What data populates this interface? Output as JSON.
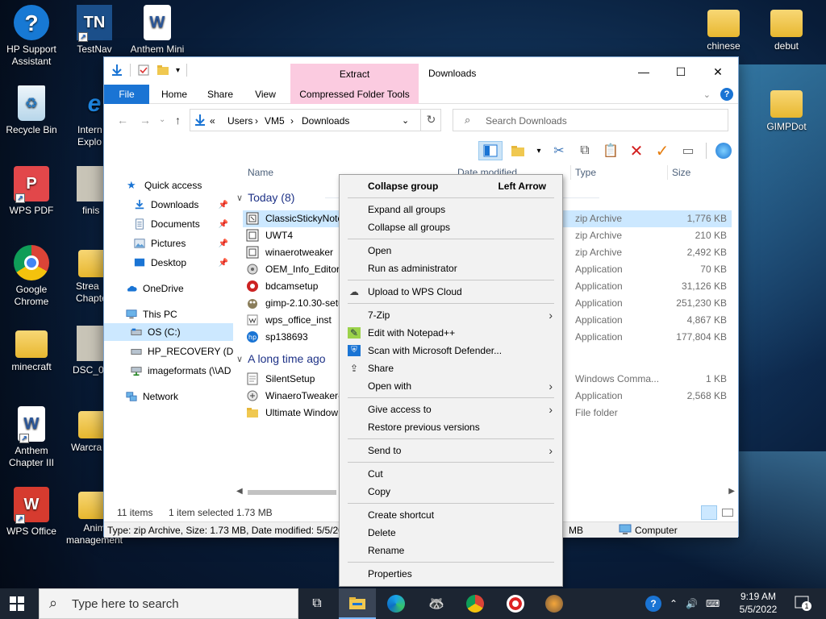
{
  "desktop": {
    "icons_left": [
      {
        "label": "HP Support Assistant"
      },
      {
        "label": "Recycle Bin"
      },
      {
        "label": "WPS PDF"
      },
      {
        "label": "Google Chrome"
      },
      {
        "label": "minecraft"
      },
      {
        "label": "Anthem Chapter III"
      },
      {
        "label": "WPS Office"
      }
    ],
    "icons_col2": [
      {
        "label": "TestNav"
      },
      {
        "label": "Intern Explo"
      },
      {
        "label": "finis"
      },
      {
        "label": "Strea Chapte"
      },
      {
        "label": "DSC_0"
      },
      {
        "label": "Warcra"
      },
      {
        "label": "Anim management"
      }
    ],
    "icon_anthem_mini": "Anthem Mini",
    "icons_right": [
      {
        "label": "chinese"
      },
      {
        "label": "debut"
      },
      {
        "label": "GIMPDot"
      }
    ]
  },
  "explorer": {
    "title": "Downloads",
    "context_tab": "Extract",
    "ribbon_tabs": [
      "File",
      "Home",
      "Share",
      "View",
      "Compressed Folder Tools"
    ],
    "address": {
      "prefix": "«",
      "crumbs": [
        "Users",
        "VM5",
        "Downloads"
      ]
    },
    "search_placeholder": "Search Downloads",
    "nav": {
      "quick_access": "Quick access",
      "pinned": [
        "Downloads",
        "Documents",
        "Pictures",
        "Desktop"
      ],
      "onedrive": "OneDrive",
      "this_pc": "This PC",
      "drives": [
        "OS (C:)",
        "HP_RECOVERY (D:)",
        "imageformats (\\\\AD"
      ],
      "network": "Network"
    },
    "columns": {
      "name": "Name",
      "date": "Date modified",
      "type": "Type",
      "size": "Size"
    },
    "groups": {
      "today": "Today (8)",
      "long_ago": "A long time ago"
    },
    "rows_today": [
      {
        "name": "ClassicStickyNote",
        "type": "zip Archive",
        "size": "1,776 KB"
      },
      {
        "name": "UWT4",
        "type": "zip Archive",
        "size": "210 KB"
      },
      {
        "name": "winaerotweaker",
        "type": "zip Archive",
        "size": "2,492 KB"
      },
      {
        "name": "OEM_Info_Editor",
        "type": "Application",
        "size": "70 KB"
      },
      {
        "name": "bdcamsetup",
        "type": "Application",
        "size": "31,126 KB"
      },
      {
        "name": "gimp-2.10.30-setu",
        "type": "Application",
        "size": "251,230 KB"
      },
      {
        "name": "wps_office_inst",
        "type": "Application",
        "size": "4,867 KB"
      },
      {
        "name": "sp138693",
        "type": "Application",
        "size": "177,804 KB"
      }
    ],
    "rows_old": [
      {
        "name": "SilentSetup",
        "type": "Windows Comma...",
        "size": "1 KB"
      },
      {
        "name": "WinaeroTweaker-",
        "type": "Application",
        "size": "2,568 KB"
      },
      {
        "name": "Ultimate Window",
        "type": "File folder",
        "size": ""
      }
    ],
    "status": {
      "count": "11 items",
      "selected": "1 item selected",
      "sel_size": "1.73 MB"
    },
    "details": {
      "text": "Type: zip Archive, Size: 1.73 MB, Date modified: 5/5/202",
      "size": "MB",
      "location": "Computer"
    }
  },
  "context_menu": {
    "collapse_group": "Collapse group",
    "collapse_group_shortcut": "Left Arrow",
    "expand_all": "Expand all groups",
    "collapse_all": "Collapse all groups",
    "open": "Open",
    "run_admin": "Run as administrator",
    "upload_wps": "Upload to WPS Cloud",
    "sevenzip": "7-Zip",
    "notepadpp": "Edit with Notepad++",
    "defender": "Scan with Microsoft Defender...",
    "share": "Share",
    "open_with": "Open with",
    "give_access": "Give access to",
    "restore": "Restore previous versions",
    "send_to": "Send to",
    "cut": "Cut",
    "copy": "Copy",
    "create_shortcut": "Create shortcut",
    "delete": "Delete",
    "rename": "Rename",
    "properties": "Properties"
  },
  "taskbar": {
    "search_placeholder": "Type here to search",
    "time": "9:19 AM",
    "date": "5/5/2022",
    "notification_count": "1"
  },
  "colors": {
    "accent": "#1a74d4",
    "selection": "#cce8ff",
    "context_tab": "#fbcbe0",
    "taskbar": "#1c2532"
  }
}
